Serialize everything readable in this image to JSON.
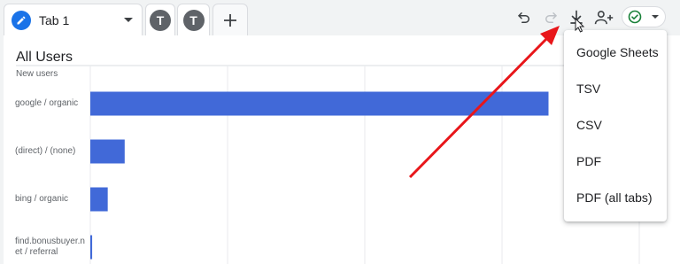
{
  "tabs": {
    "active": {
      "label": "Tab 1"
    },
    "avatar_1": {
      "letter": "T"
    },
    "avatar_2": {
      "letter": "T"
    },
    "add_label": "+"
  },
  "toolbar": {
    "icons": [
      "undo-icon",
      "redo-icon",
      "download-icon",
      "share-users-icon",
      "check-circle-icon"
    ]
  },
  "card": {
    "title": "All Users",
    "metric_label": "New users"
  },
  "chart_data": {
    "type": "bar",
    "orientation": "horizontal",
    "title": "All Users",
    "ylabel": "New users",
    "categories": [
      "google / organic",
      "(direct) / (none)",
      "bing / organic",
      "find.bonusbuyer.n\net / referral"
    ],
    "values": [
      100,
      7.5,
      3.8,
      0.4
    ],
    "xlim": [
      0,
      120
    ],
    "grid": true,
    "bar_color": "#4169d8"
  },
  "menu": {
    "items": [
      "Google Sheets",
      "TSV",
      "CSV",
      "PDF",
      "PDF (all tabs)"
    ]
  },
  "colors": {
    "accent": "#1a73e8",
    "bar": "#4169d8",
    "annotation_arrow": "#e8161a",
    "status_green": "#188038"
  }
}
